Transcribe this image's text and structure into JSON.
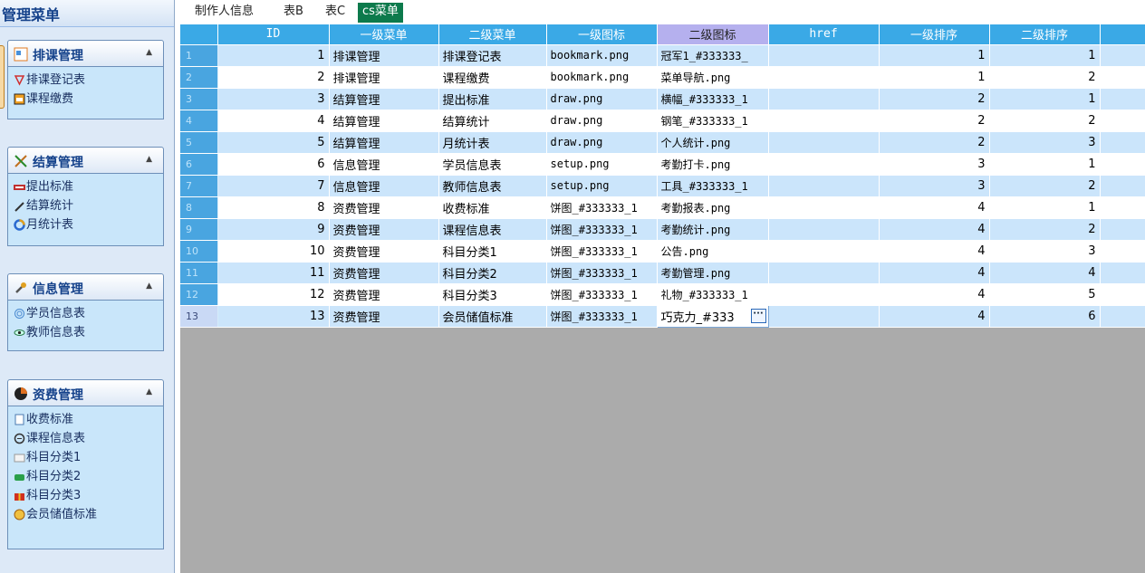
{
  "sidebar": {
    "title": "管理菜单",
    "groups": [
      {
        "title": "排课管理",
        "icon": "calendar-icon",
        "items": [
          {
            "label": "排课登记表",
            "icon": "bookmark-icon"
          },
          {
            "label": "课程缴费",
            "icon": "bookmark-icon"
          }
        ]
      },
      {
        "title": "结算管理",
        "icon": "draw-icon",
        "items": [
          {
            "label": "提出标准",
            "icon": "banner-icon"
          },
          {
            "label": "结算统计",
            "icon": "pen-icon"
          },
          {
            "label": "月统计表",
            "icon": "pie-chart-icon"
          }
        ]
      },
      {
        "title": "信息管理",
        "icon": "setup-icon",
        "items": [
          {
            "label": "学员信息表",
            "icon": "fingerprint-icon"
          },
          {
            "label": "教师信息表",
            "icon": "eye-icon"
          }
        ]
      },
      {
        "title": "资费管理",
        "icon": "pie-icon",
        "items": [
          {
            "label": "收费标准",
            "icon": "report-icon"
          },
          {
            "label": "课程信息表",
            "icon": "stats-icon"
          },
          {
            "label": "科目分类1",
            "icon": "notice-icon"
          },
          {
            "label": "科目分类2",
            "icon": "manage-icon"
          },
          {
            "label": "科目分类3",
            "icon": "gift-icon"
          },
          {
            "label": "会员储值标准",
            "icon": "chocolate-icon"
          }
        ]
      }
    ]
  },
  "tabs": [
    {
      "label": "制作人信息",
      "active": false
    },
    {
      "label": "表B",
      "active": false
    },
    {
      "label": "表C",
      "active": false
    },
    {
      "label": "cs菜单",
      "active": true
    }
  ],
  "grid": {
    "columns": [
      "ID",
      "一级菜单",
      "二级菜单",
      "一级图标",
      "二级图标",
      "href",
      "一级排序",
      "二级排序"
    ],
    "selected_column": "二级图标",
    "current_row": 13,
    "rows": [
      {
        "rn": "1",
        "id": "1",
        "m1": "排课管理",
        "m2": "排课登记表",
        "i1": "bookmark.png",
        "i2": "冠军1_#333333_",
        "href": "",
        "s1": "1",
        "s2": "1"
      },
      {
        "rn": "2",
        "id": "2",
        "m1": "排课管理",
        "m2": "课程缴费",
        "i1": "bookmark.png",
        "i2": "菜单导航.png",
        "href": "",
        "s1": "1",
        "s2": "2"
      },
      {
        "rn": "3",
        "id": "3",
        "m1": "结算管理",
        "m2": "提出标准",
        "i1": "draw.png",
        "i2": "横幅_#333333_1",
        "href": "",
        "s1": "2",
        "s2": "1"
      },
      {
        "rn": "4",
        "id": "4",
        "m1": "结算管理",
        "m2": "结算统计",
        "i1": "draw.png",
        "i2": "钢笔_#333333_1",
        "href": "",
        "s1": "2",
        "s2": "2"
      },
      {
        "rn": "5",
        "id": "5",
        "m1": "结算管理",
        "m2": "月统计表",
        "i1": "draw.png",
        "i2": "个人统计.png",
        "href": "",
        "s1": "2",
        "s2": "3"
      },
      {
        "rn": "6",
        "id": "6",
        "m1": "信息管理",
        "m2": "学员信息表",
        "i1": "setup.png",
        "i2": "考勤打卡.png",
        "href": "",
        "s1": "3",
        "s2": "1"
      },
      {
        "rn": "7",
        "id": "7",
        "m1": "信息管理",
        "m2": "教师信息表",
        "i1": "setup.png",
        "i2": "工具_#333333_1",
        "href": "",
        "s1": "3",
        "s2": "2"
      },
      {
        "rn": "8",
        "id": "8",
        "m1": "资费管理",
        "m2": "收费标准",
        "i1": "饼图_#333333_1",
        "i2": "考勤报表.png",
        "href": "",
        "s1": "4",
        "s2": "1"
      },
      {
        "rn": "9",
        "id": "9",
        "m1": "资费管理",
        "m2": "课程信息表",
        "i1": "饼图_#333333_1",
        "i2": "考勤统计.png",
        "href": "",
        "s1": "4",
        "s2": "2"
      },
      {
        "rn": "10",
        "id": "10",
        "m1": "资费管理",
        "m2": "科目分类1",
        "i1": "饼图_#333333_1",
        "i2": "公告.png",
        "href": "",
        "s1": "4",
        "s2": "3"
      },
      {
        "rn": "11",
        "id": "11",
        "m1": "资费管理",
        "m2": "科目分类2",
        "i1": "饼图_#333333_1",
        "i2": "考勤管理.png",
        "href": "",
        "s1": "4",
        "s2": "4"
      },
      {
        "rn": "12",
        "id": "12",
        "m1": "资费管理",
        "m2": "科目分类3",
        "i1": "饼图_#333333_1",
        "i2": "礼物_#333333_1",
        "href": "",
        "s1": "4",
        "s2": "5"
      },
      {
        "rn": "13",
        "id": "13",
        "m1": "资费管理",
        "m2": "会员储值标准",
        "i1": "饼图_#333333_1",
        "i2": "巧克力_#333",
        "href": "",
        "s1": "4",
        "s2": "6"
      }
    ]
  },
  "colors": {
    "header": "#3aa9e6",
    "selected_header": "#b5b0ee",
    "active_tab": "#0d7a4c",
    "row_alt": "#cbe5fb"
  }
}
